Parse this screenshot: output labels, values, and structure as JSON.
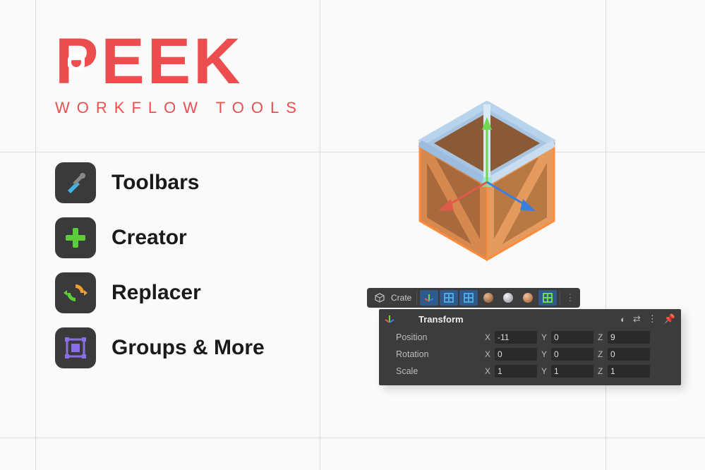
{
  "logo": {
    "title": "PEEK",
    "subtitle": "WORKFLOW TOOLS"
  },
  "features": [
    {
      "icon": "tools-icon",
      "label": "Toolbars"
    },
    {
      "icon": "plus-icon",
      "label": "Creator"
    },
    {
      "icon": "refresh-icon",
      "label": "Replacer"
    },
    {
      "icon": "group-icon",
      "label": "Groups & More"
    }
  ],
  "toolbar": {
    "object_label": "Crate",
    "items": [
      {
        "name": "cube-icon"
      },
      {
        "name": "transform-gizmo-icon",
        "selected": true
      },
      {
        "name": "mesh-grid-blue-icon",
        "selected": true
      },
      {
        "name": "mesh-grid-blue2-icon",
        "selected": true
      },
      {
        "name": "material-brown-icon"
      },
      {
        "name": "material-grey-icon"
      },
      {
        "name": "material-orange-icon"
      },
      {
        "name": "mesh-grid-green-icon",
        "selected": true
      }
    ]
  },
  "inspector": {
    "title": "Transform",
    "rows": [
      {
        "label": "Position",
        "x": "-11",
        "y": "0",
        "z": "9"
      },
      {
        "label": "Rotation",
        "x": "0",
        "y": "0",
        "z": "0"
      },
      {
        "label": "Scale",
        "x": "1",
        "y": "1",
        "z": "1"
      }
    ]
  },
  "axis_labels": {
    "x": "X",
    "y": "Y",
    "z": "Z"
  },
  "colors": {
    "brand": "#ec4e50",
    "panel": "#3c3c3c",
    "axis_x": "#e05a4a",
    "axis_y": "#6fd94f",
    "axis_z": "#3a7fe0"
  }
}
